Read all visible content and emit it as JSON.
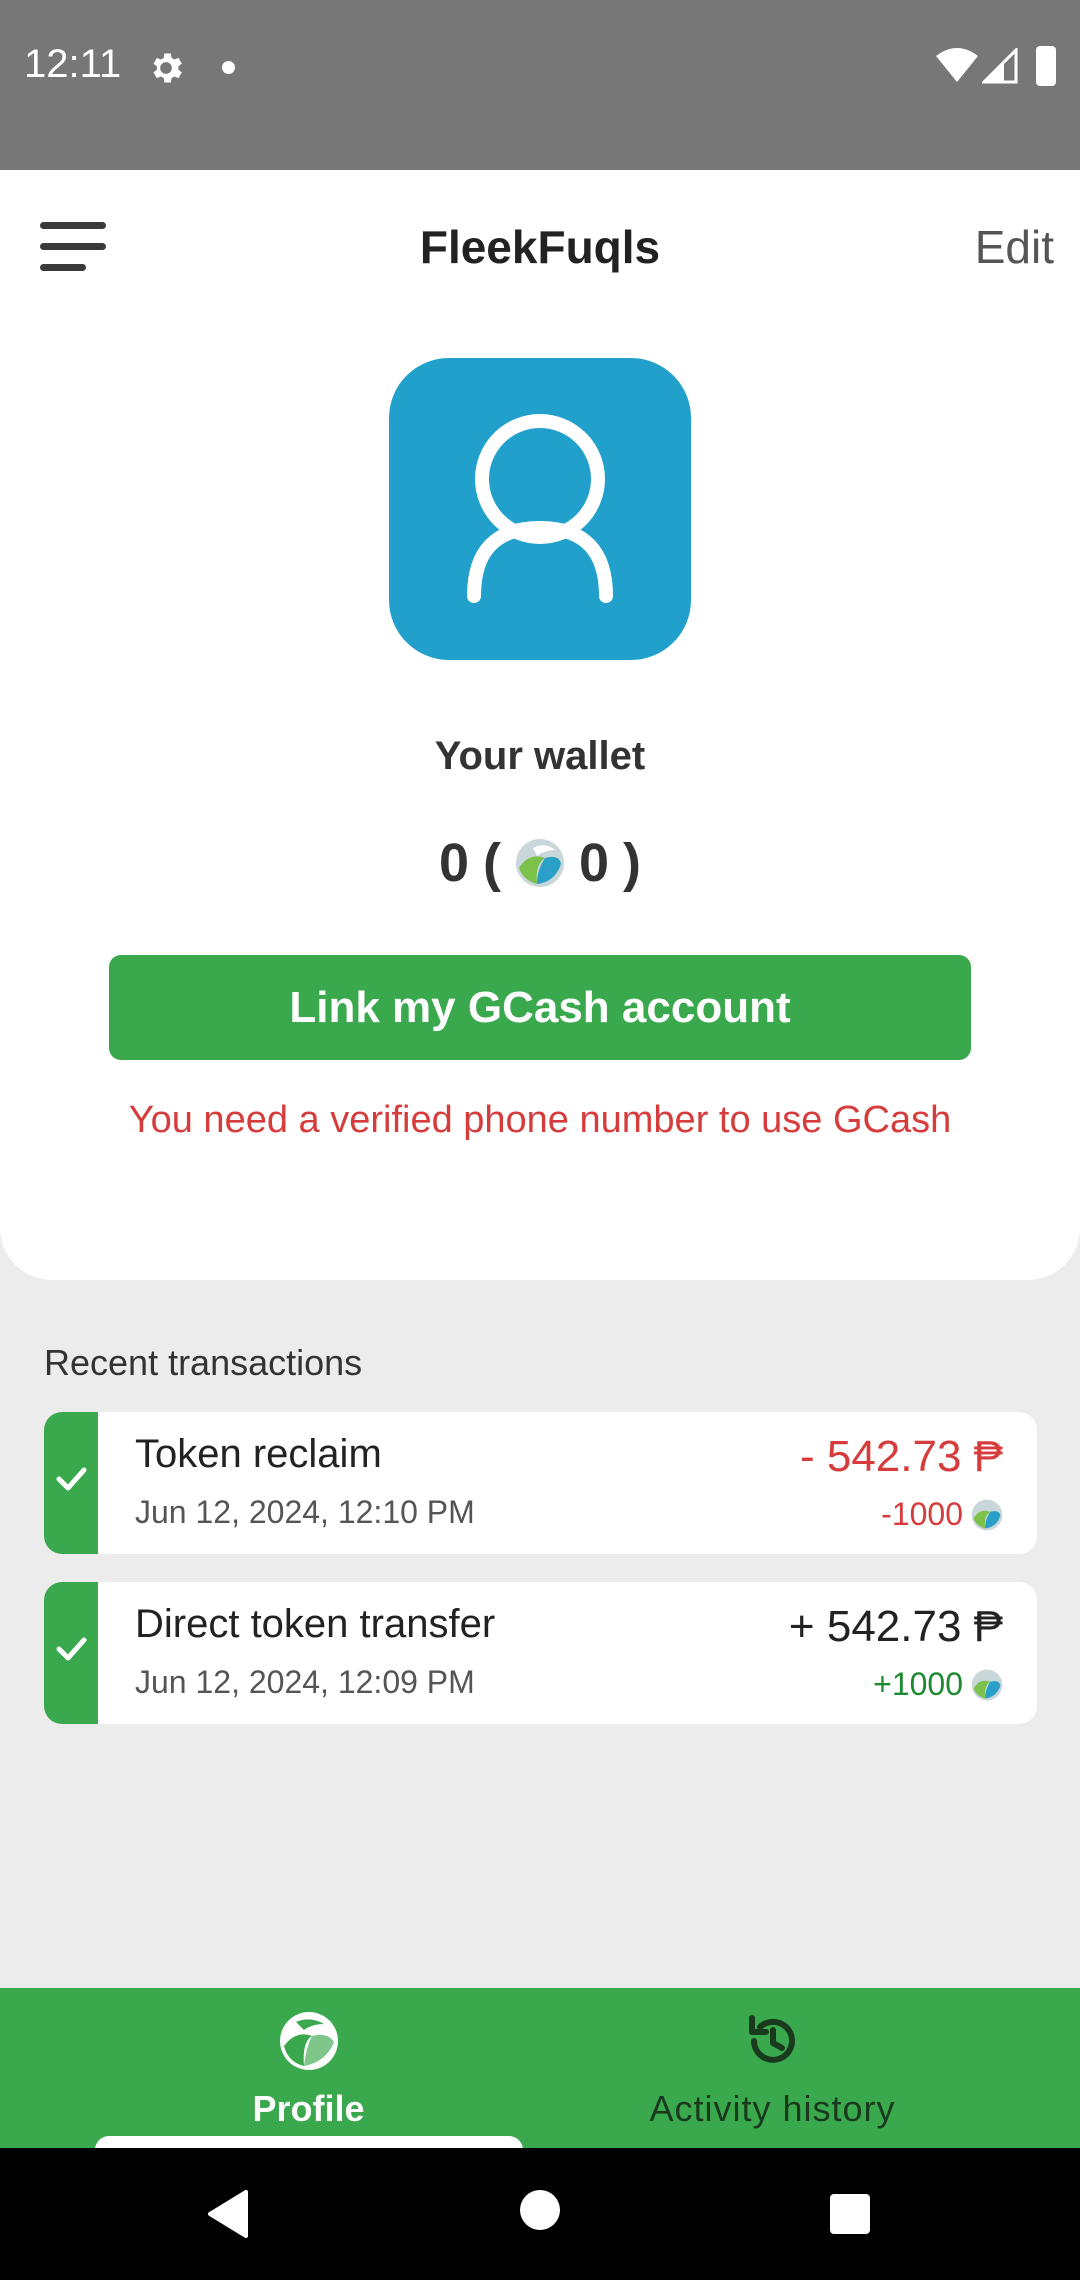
{
  "status_bar": {
    "time": "12:11"
  },
  "header": {
    "title": "FleekFuqls",
    "edit_label": "Edit"
  },
  "wallet": {
    "label": "Your wallet",
    "balance": "0",
    "open_paren": "(",
    "token_balance": "0",
    "close_paren": ")"
  },
  "link_button": {
    "label": "Link my GCash account"
  },
  "warning": {
    "text": "You need a verified phone number to use GCash"
  },
  "transactions": {
    "section_label": "Recent transactions",
    "items": [
      {
        "title": "Token reclaim",
        "date": "Jun 12, 2024, 12:10 PM",
        "amount": "- 542.73 ₱",
        "tokens": "-1000",
        "direction": "out"
      },
      {
        "title": "Direct token transfer",
        "date": "Jun 12, 2024, 12:09 PM",
        "amount": "+ 542.73 ₱",
        "tokens": "+1000",
        "direction": "in"
      }
    ]
  },
  "bottom_nav": {
    "items": [
      {
        "label": "Profile",
        "icon": "globe-leaf-icon",
        "active": true
      },
      {
        "label": "Activity history",
        "icon": "history-icon",
        "active": false
      }
    ]
  },
  "colors": {
    "accent_green": "#3aa84c",
    "avatar_blue": "#21a0cc",
    "error_red": "#d63c3c",
    "positive_green": "#1e8a30"
  }
}
